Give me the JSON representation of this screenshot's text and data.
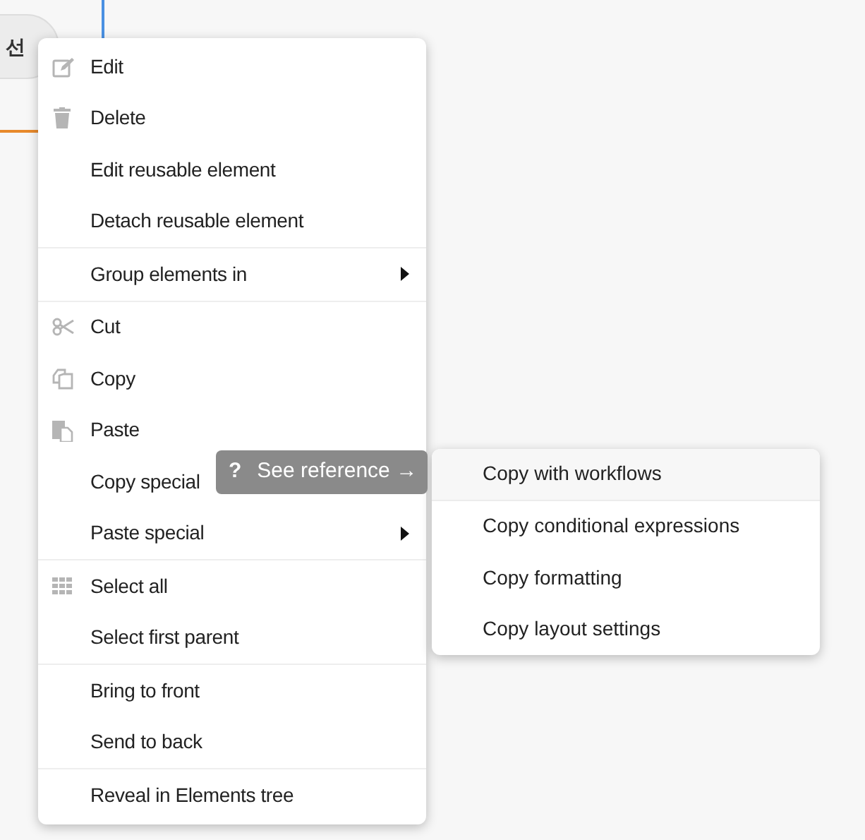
{
  "canvas_button": {
    "label": "선"
  },
  "menu": {
    "groups": [
      [
        {
          "label": "Edit",
          "kind": "edit",
          "has_submenu": false
        },
        {
          "label": "Delete",
          "kind": "delete",
          "has_submenu": false
        },
        {
          "label": "Edit reusable element",
          "has_submenu": false
        },
        {
          "label": "Detach reusable element",
          "has_submenu": false
        }
      ],
      [
        {
          "label": "Group elements in",
          "has_submenu": true
        }
      ],
      [
        {
          "label": "Cut",
          "kind": "cut",
          "has_submenu": false
        },
        {
          "label": "Copy",
          "kind": "copy",
          "has_submenu": false
        },
        {
          "label": "Paste",
          "kind": "paste",
          "has_submenu": false
        },
        {
          "label": "Copy special"
        },
        {
          "label": "Paste special",
          "has_submenu": true
        }
      ],
      [
        {
          "label": "Select all",
          "kind": "select_all",
          "has_submenu": false
        },
        {
          "label": "Select first parent",
          "has_submenu": false
        }
      ],
      [
        {
          "label": "Bring to front",
          "has_submenu": false
        },
        {
          "label": "Send to back",
          "has_submenu": false
        }
      ],
      [
        {
          "label": "Reveal in Elements tree",
          "has_submenu": false
        }
      ]
    ]
  },
  "tooltip": {
    "icon_text": "?",
    "label": "See reference →"
  },
  "submenu": {
    "items": [
      {
        "label": "Copy with workflows",
        "selected": true
      },
      {
        "label": "Copy conditional expressions",
        "selected": false
      },
      {
        "label": "Copy formatting",
        "selected": false
      },
      {
        "label": "Copy layout settings",
        "selected": false
      }
    ]
  }
}
